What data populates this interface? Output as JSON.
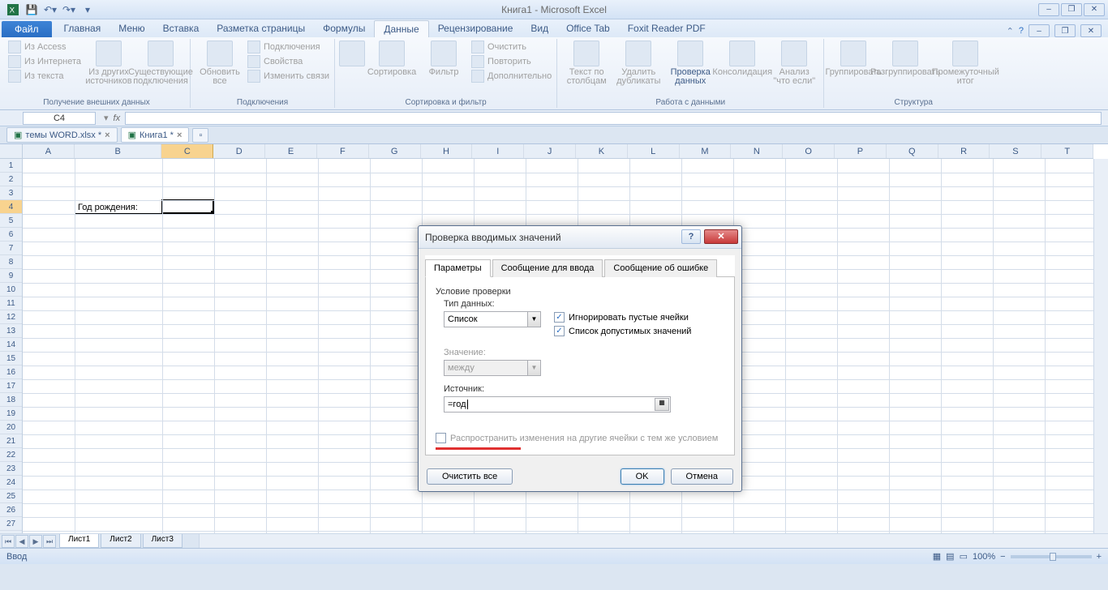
{
  "app_title": "Книга1 - Microsoft Excel",
  "qat_icons": [
    "excel",
    "save",
    "undo",
    "redo"
  ],
  "win_controls": {
    "min": "–",
    "max": "❐",
    "close": "✕"
  },
  "file_tab": "Файл",
  "ribbon_tabs": [
    "Главная",
    "Меню",
    "Вставка",
    "Разметка страницы",
    "Формулы",
    "Данные",
    "Рецензирование",
    "Вид",
    "Office Tab",
    "Foxit Reader PDF"
  ],
  "active_ribbon": 5,
  "ribbon": {
    "g1": {
      "label": "Получение внешних данных",
      "small": [
        "Из Access",
        "Из Интернета",
        "Из текста"
      ],
      "big1": "Из других источников",
      "big2": "Существующие подключения"
    },
    "g2": {
      "label": "Подключения",
      "big": "Обновить все",
      "small": [
        "Подключения",
        "Свойства",
        "Изменить связи"
      ]
    },
    "g3": {
      "label": "Сортировка и фильтр",
      "b1": "",
      "b2": "Сортировка",
      "b3": "Фильтр",
      "small": [
        "Очистить",
        "Повторить",
        "Дополнительно"
      ]
    },
    "g4": {
      "label": "Работа с данными",
      "b1": "Текст по столбцам",
      "b2": "Удалить дубликаты",
      "b3": "Проверка данных",
      "b4": "Консолидация",
      "b5": "Анализ \"что если\""
    },
    "g5": {
      "label": "Структура",
      "b1": "Группировать",
      "b2": "Разгруппировать",
      "b3": "Промежуточный итог"
    }
  },
  "namebox": "C4",
  "doc_tabs": [
    {
      "label": "темы WORD.xlsx *",
      "active": false
    },
    {
      "label": "Книга1 *",
      "active": true
    }
  ],
  "columns": [
    "A",
    "B",
    "C",
    "D",
    "E",
    "F",
    "G",
    "H",
    "I",
    "J",
    "K",
    "L",
    "M",
    "N",
    "O",
    "P",
    "Q",
    "R",
    "S",
    "T"
  ],
  "rows": [
    1,
    2,
    3,
    4,
    5,
    6,
    7,
    8,
    9,
    10,
    11,
    12,
    13,
    14,
    15,
    16,
    17,
    18,
    19,
    20,
    21,
    22,
    23,
    24,
    25,
    26,
    27
  ],
  "selected_col_idx": 2,
  "selected_row_idx": 3,
  "cell_b4": "Год рождения:",
  "sheets": [
    "Лист1",
    "Лист2",
    "Лист3"
  ],
  "status_left": "Ввод",
  "zoom": "100%",
  "dialog": {
    "title": "Проверка вводимых значений",
    "tabs": [
      "Параметры",
      "Сообщение для ввода",
      "Сообщение об ошибке"
    ],
    "section": "Условие проверки",
    "type_label": "Тип данных:",
    "type_value": "Список",
    "value_label": "Значение:",
    "value_value": "между",
    "chk1": "Игнорировать пустые ячейки",
    "chk2": "Список допустимых значений",
    "source_label": "Источник:",
    "source_value": "=год",
    "propagate": "Распространить изменения на другие ячейки с тем же условием",
    "clear": "Очистить все",
    "ok": "OK",
    "cancel": "Отмена"
  }
}
